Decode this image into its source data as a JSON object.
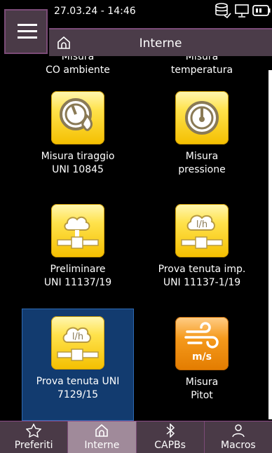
{
  "status": {
    "datetime": "27.03.24 - 14:46"
  },
  "header": {
    "title": "Interne"
  },
  "tiles": [
    {
      "line1": "Misura",
      "line2": "CO ambiente"
    },
    {
      "line1": "Misura",
      "line2": "temperatura"
    },
    {
      "line1": "Misura tiraggio",
      "line2": "UNI 10845",
      "icon": "draught-gauge-icon"
    },
    {
      "line1": "Misura",
      "line2": "pressione",
      "icon": "pressure-gauge-icon"
    },
    {
      "line1": "Preliminare",
      "line2": "UNI 11137/19",
      "icon": "pipe-cloud-icon"
    },
    {
      "line1": "Prova tenuta imp.",
      "line2": "UNI 11137-1/19",
      "icon": "pipe-leak-lh-icon",
      "badge": "l/h"
    },
    {
      "line1": "Prova tenuta UNI",
      "line2": "7129/15",
      "icon": "pipe-leak-lh-icon",
      "badge": "l/h"
    },
    {
      "line1": "Misura",
      "line2": "Pitot",
      "icon": "wind-ms-icon",
      "badge": "m/s"
    }
  ],
  "nav": [
    {
      "label": "Preferiti",
      "icon": "star-icon"
    },
    {
      "label": "Interne",
      "icon": "home-icon"
    },
    {
      "label": "CAPBs",
      "icon": "bluetooth-icon"
    },
    {
      "label": "Macros",
      "icon": "user-icon"
    }
  ],
  "colors": {
    "header": "#4b3c49",
    "accent": "#7b4b77",
    "selected": "#123b6f",
    "tile_yellow": "#ffe24c",
    "tile_orange": "#f59a1c"
  }
}
